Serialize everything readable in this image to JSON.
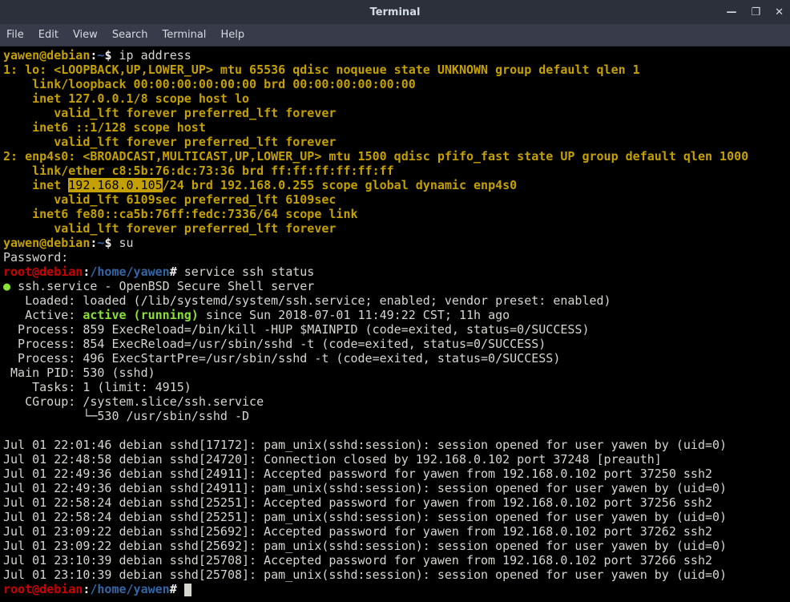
{
  "window": {
    "title": "Terminal",
    "buttons": {
      "min": "—",
      "max": "❐",
      "close": "✕"
    }
  },
  "menu": [
    "File",
    "Edit",
    "View",
    "Search",
    "Terminal",
    "Help"
  ],
  "prompt1": {
    "user": "yawen@debian",
    "sep": ":",
    "path": "~",
    "dollar": "$ "
  },
  "rootprompt": {
    "user": "root@debian",
    "sep": ":",
    "path": "/home/yawen",
    "hash": "# "
  },
  "cmd": {
    "ipaddr": "ip address",
    "su": "su",
    "password": "Password:",
    "sshstatus": "service ssh status"
  },
  "ip": {
    "lo_header": "1: lo: <LOOPBACK,UP,LOWER_UP> mtu 65536 qdisc noqueue state UNKNOWN group default qlen 1",
    "lo_link": "    link/loopback 00:00:00:00:00:00 brd 00:00:00:00:00:00",
    "lo_inet": "    inet 127.0.0.1/8 scope host lo",
    "lo_valid": "       valid_lft forever preferred_lft forever",
    "lo_inet6": "    inet6 ::1/128 scope host ",
    "lo_valid6": "       valid_lft forever preferred_lft forever",
    "en_header": "2: enp4s0: <BROADCAST,MULTICAST,UP,LOWER_UP> mtu 1500 qdisc pfifo_fast state UP group default qlen 1000",
    "en_link": "    link/ether c8:5b:76:dc:73:36 brd ff:ff:ff:ff:ff:ff",
    "en_inet_pre": "    inet ",
    "en_inet_ip": "192.168.0.105",
    "en_inet_post": "/24 brd 192.168.0.255 scope global dynamic enp4s0",
    "en_valid": "       valid_lft 6109sec preferred_lft 6109sec",
    "en_inet6": "    inet6 fe80::ca5b:76ff:fedc:7336/64 scope link ",
    "en_valid6": "       valid_lft forever preferred_lft forever"
  },
  "ssh": {
    "bullet": "● ",
    "svc": "ssh.service - OpenBSD Secure Shell server",
    "loaded": "   Loaded: loaded (/lib/systemd/system/ssh.service; enabled; vendor preset: enabled)",
    "active_pre": "   Active: ",
    "active_state": "active (running)",
    "active_post": " since Sun 2018-07-01 11:49:22 CST; 11h ago",
    "p859": "  Process: 859 ExecReload=/bin/kill -HUP $MAINPID (code=exited, status=0/SUCCESS)",
    "p854": "  Process: 854 ExecReload=/usr/sbin/sshd -t (code=exited, status=0/SUCCESS)",
    "p496": "  Process: 496 ExecStartPre=/usr/sbin/sshd -t (code=exited, status=0/SUCCESS)",
    "mainpid": " Main PID: 530 (sshd)",
    "tasks": "    Tasks: 1 (limit: 4915)",
    "cgroup": "   CGroup: /system.slice/ssh.service",
    "cgline": "           └─530 /usr/sbin/sshd -D"
  },
  "log": [
    "Jul 01 22:01:46 debian sshd[17172]: pam_unix(sshd:session): session opened for user yawen by (uid=0)",
    "Jul 01 22:48:58 debian sshd[24720]: Connection closed by 192.168.0.102 port 37248 [preauth]",
    "Jul 01 22:49:36 debian sshd[24911]: Accepted password for yawen from 192.168.0.102 port 37250 ssh2",
    "Jul 01 22:49:36 debian sshd[24911]: pam_unix(sshd:session): session opened for user yawen by (uid=0)",
    "Jul 01 22:58:24 debian sshd[25251]: Accepted password for yawen from 192.168.0.102 port 37256 ssh2",
    "Jul 01 22:58:24 debian sshd[25251]: pam_unix(sshd:session): session opened for user yawen by (uid=0)",
    "Jul 01 23:09:22 debian sshd[25692]: Accepted password for yawen from 192.168.0.102 port 37262 ssh2",
    "Jul 01 23:09:22 debian sshd[25692]: pam_unix(sshd:session): session opened for user yawen by (uid=0)",
    "Jul 01 23:10:39 debian sshd[25708]: Accepted password for yawen from 192.168.0.102 port 37266 ssh2",
    "Jul 01 23:10:39 debian sshd[25708]: pam_unix(sshd:session): session opened for user yawen by (uid=0)"
  ]
}
